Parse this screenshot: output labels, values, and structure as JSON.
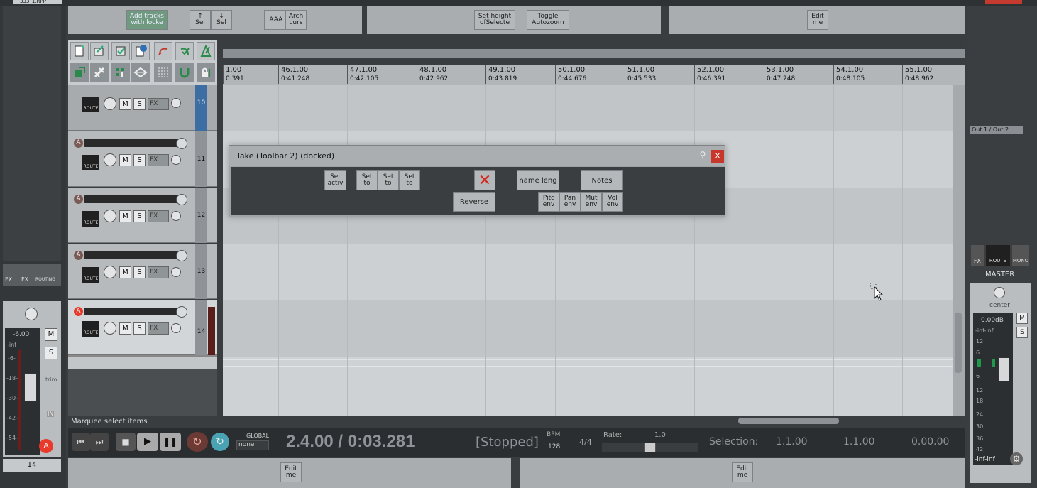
{
  "project_tab": "333_1.RPP",
  "top_toolbar": {
    "add_tracks": "Add tracks\nwith locke",
    "sel_up": "↑\nSel",
    "sel_down": "↓\nSel",
    "aaa": "!AAA",
    "arch": "Arch\ncurs",
    "set_height": "Set height\nofSelecte",
    "toggle_autozoom": "Toggle\nAutozoom",
    "edit_me": "Edit\nme"
  },
  "ruler": {
    "ticks": [
      {
        "bar": "1.00",
        "time": "0.391"
      },
      {
        "bar": "46.1.00",
        "time": "0:41.248"
      },
      {
        "bar": "47.1.00",
        "time": "0:42.105"
      },
      {
        "bar": "48.1.00",
        "time": "0:42.962"
      },
      {
        "bar": "49.1.00",
        "time": "0:43.819"
      },
      {
        "bar": "50.1.00",
        "time": "0:44.676"
      },
      {
        "bar": "51.1.00",
        "time": "0:45.533"
      },
      {
        "bar": "52.1.00",
        "time": "0:46.391"
      },
      {
        "bar": "53.1.00",
        "time": "0:47.248"
      },
      {
        "bar": "54.1.00",
        "time": "0:48.105"
      },
      {
        "bar": "55.1.00",
        "time": "0:48.962"
      }
    ]
  },
  "tracks": [
    {
      "number": "10",
      "arm": "A"
    },
    {
      "number": "11",
      "arm": "A"
    },
    {
      "number": "12",
      "arm": "A"
    },
    {
      "number": "13",
      "arm": "A"
    },
    {
      "number": "14",
      "arm": "A"
    }
  ],
  "track_labels": {
    "mute": "M",
    "solo": "S",
    "fx": "FX",
    "route": "ROUTE"
  },
  "take_toolbar": {
    "title": "Take (Toolbar 2) (docked)",
    "set_active": "Set\nactiv",
    "set_to_1": "Set\nto",
    "set_to_2": "Set\nto",
    "set_to_3": "Set\nto",
    "reverse": "Reverse",
    "name_length": "name leng",
    "notes": "Notes",
    "pitch_env": "Pitc\nenv",
    "pan_env": "Pan\nenv",
    "mute_env": "Mut\nenv",
    "vol_env": "Vol\nenv"
  },
  "left_mixer": {
    "fx": "FX",
    "routing": "ROUTING",
    "volume_db": "-6.00",
    "inf": "-inf",
    "scale": [
      "-6-",
      "-18-",
      "-30-",
      "-42-",
      "-54-"
    ],
    "mute": "M",
    "solo": "S",
    "trim": "trim",
    "track_number": "14",
    "in": "IN"
  },
  "status": {
    "marquee": "Marquee select items"
  },
  "transport": {
    "global": "GLOBAL",
    "none": "none",
    "position": "2.4.00 / 0:03.281",
    "state": "[Stopped]",
    "bpm_label": "BPM",
    "bpm": "128",
    "time_sig": "4/4",
    "rate_label": "Rate:",
    "rate": "1.0",
    "selection_label": "Selection:",
    "sel_start": "1.1.00",
    "sel_end": "1.1.00",
    "sel_len": "0.00.00"
  },
  "bottom_toolbar": {
    "edit_me_1": "Edit\nme",
    "edit_me_2": "Edit\nme"
  },
  "master": {
    "output": "Out 1 / Out 2",
    "fx": "FX",
    "route": "ROUTE",
    "mono": "MONO",
    "title": "MASTER",
    "pan": "center",
    "db": "0.00dB",
    "inf": "-inf-inf",
    "mute": "M",
    "solo": "S",
    "scale": [
      "12",
      "6",
      "6",
      "12",
      "18",
      "24",
      "30",
      "36",
      "42",
      "54"
    ],
    "bottom_inf": "-inf-inf"
  }
}
